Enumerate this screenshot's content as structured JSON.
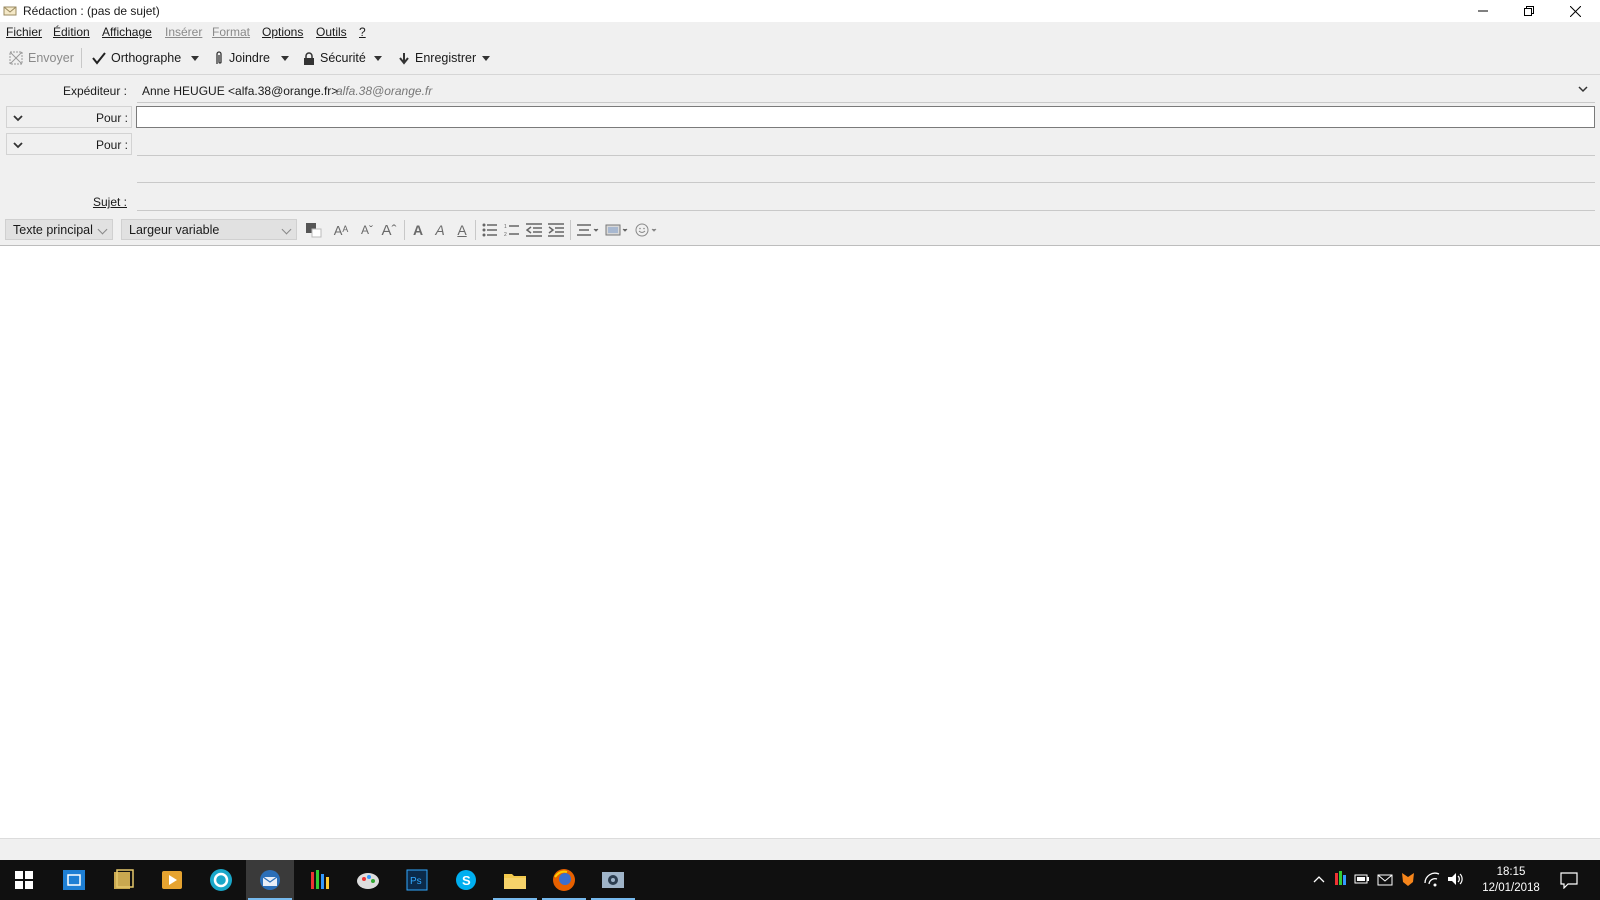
{
  "window": {
    "title": "Rédaction : (pas de sujet)"
  },
  "menu": [
    "Fichier",
    "Édition",
    "Affichage",
    "Insérer",
    "Format",
    "Options",
    "Outils",
    "?"
  ],
  "toolbar": {
    "send": "Envoyer",
    "spell": "Orthographe",
    "attach": "Joindre",
    "security": "Sécurité",
    "save": "Enregistrer"
  },
  "headers": {
    "from_label": "Expéditeur :",
    "from_value": "Anne HEUGUE <alfa.38@orange.fr>",
    "from_hint": "alfa.38@orange.fr",
    "to_label_1": "Pour :",
    "to_label_2": "Pour :",
    "to_value_1": "",
    "subject_label": "Sujet :",
    "subject_value": ""
  },
  "format": {
    "paragraph_style": "Texte principal",
    "font": "Largeur variable"
  },
  "taskbar": {
    "time": "18:15",
    "date": "12/01/2018"
  },
  "colors": {
    "chrome": "#f0f0f0",
    "taskbar": "#101010",
    "active_accent": "#76b9ed"
  }
}
